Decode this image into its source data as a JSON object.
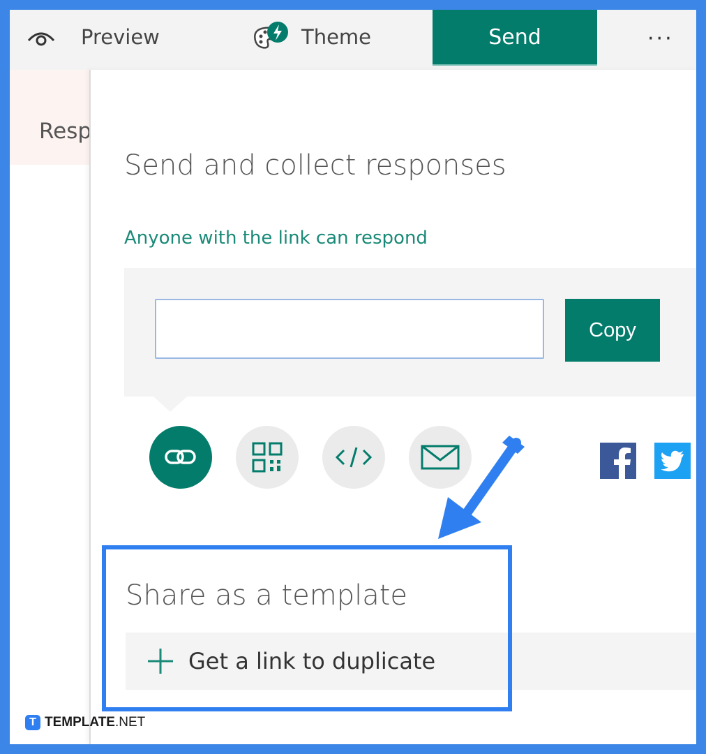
{
  "topbar": {
    "preview_label": "Preview",
    "theme_label": "Theme",
    "send_label": "Send",
    "more_label": "···"
  },
  "left": {
    "responses_tab": "Resp"
  },
  "send_panel": {
    "title": "Send and collect responses",
    "access_text": "Anyone with the link can respond",
    "link_value": "",
    "copy_label": "Copy",
    "share_options": [
      "link-icon",
      "qr-code-icon",
      "embed-code-icon",
      "email-icon"
    ],
    "social": [
      "facebook-icon",
      "twitter-icon"
    ]
  },
  "template": {
    "title": "Share as a template",
    "duplicate_label": "Get a link to duplicate"
  },
  "watermark": {
    "brand_bold": "TEMPLATE",
    "brand_rest": ".NET",
    "icon_letter": "T"
  },
  "colors": {
    "accent": "#037c6b",
    "link_text": "#1a8a78",
    "annotation": "#2f7ff0",
    "facebook": "#3b5998",
    "twitter": "#1da1f2"
  }
}
